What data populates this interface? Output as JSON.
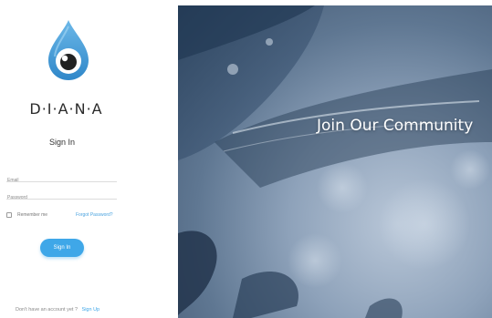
{
  "brand": {
    "name": "D·I·A·N·A",
    "logo_icon": "water-drop-eye-icon"
  },
  "signin": {
    "title": "Sign In",
    "email_placeholder": "Email",
    "password_placeholder": "Password",
    "remember_label": "Remember me",
    "forgot_label": "Forgot Password?",
    "submit_label": "Sign In",
    "no_account_text": "Don't have an account yet ?",
    "signup_label": "Sign Up"
  },
  "hero": {
    "title": "Join Our Community",
    "background": "water-splash-photo"
  },
  "colors": {
    "accent": "#3fa7e8",
    "drop": "#4da3dc",
    "hero_dark": "#3f546e"
  }
}
